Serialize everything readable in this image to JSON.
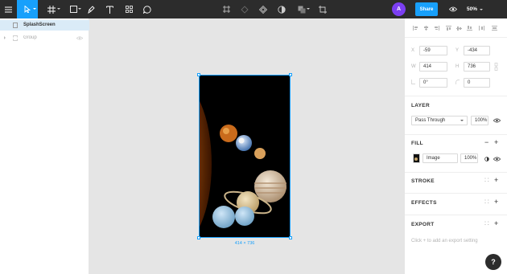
{
  "toolbar": {
    "icons": [
      "menu-icon",
      "move-tool-icon",
      "frame-tool-icon",
      "shape-tool-icon",
      "pen-tool-icon",
      "text-tool-icon",
      "components-icon",
      "comment-icon",
      "frame-selection-icon",
      "component-icon",
      "mask-icon",
      "contrast-icon",
      "boolean-icon",
      "crop-icon",
      "eye-icon"
    ],
    "avatar_initial": "A",
    "share_label": "Share",
    "zoom_label": "50%",
    "accent": "#18a0fb",
    "bg": "#2c2c2c"
  },
  "layers": {
    "items": [
      {
        "label": "SplashScreen",
        "selected": true
      },
      {
        "label": "Group",
        "selected": false
      }
    ]
  },
  "canvas": {
    "frame_size_label": "414 × 736"
  },
  "props": {
    "x": {
      "label": "X",
      "value": "-59"
    },
    "y": {
      "label": "Y",
      "value": "-434"
    },
    "w": {
      "label": "W",
      "value": "414"
    },
    "h": {
      "label": "H",
      "value": "736"
    },
    "rotation": {
      "value": "0°"
    },
    "radius": {
      "value": "0"
    },
    "layer": {
      "title": "LAYER",
      "blend_mode": "Pass Through",
      "opacity": "100%"
    },
    "fill": {
      "title": "FILL",
      "type": "Image",
      "opacity": "100%"
    },
    "stroke_title": "STROKE",
    "effects_title": "EFFECTS",
    "export_title": "EXPORT",
    "export_hint": "Click + to add an export setting"
  },
  "help_label": "?"
}
